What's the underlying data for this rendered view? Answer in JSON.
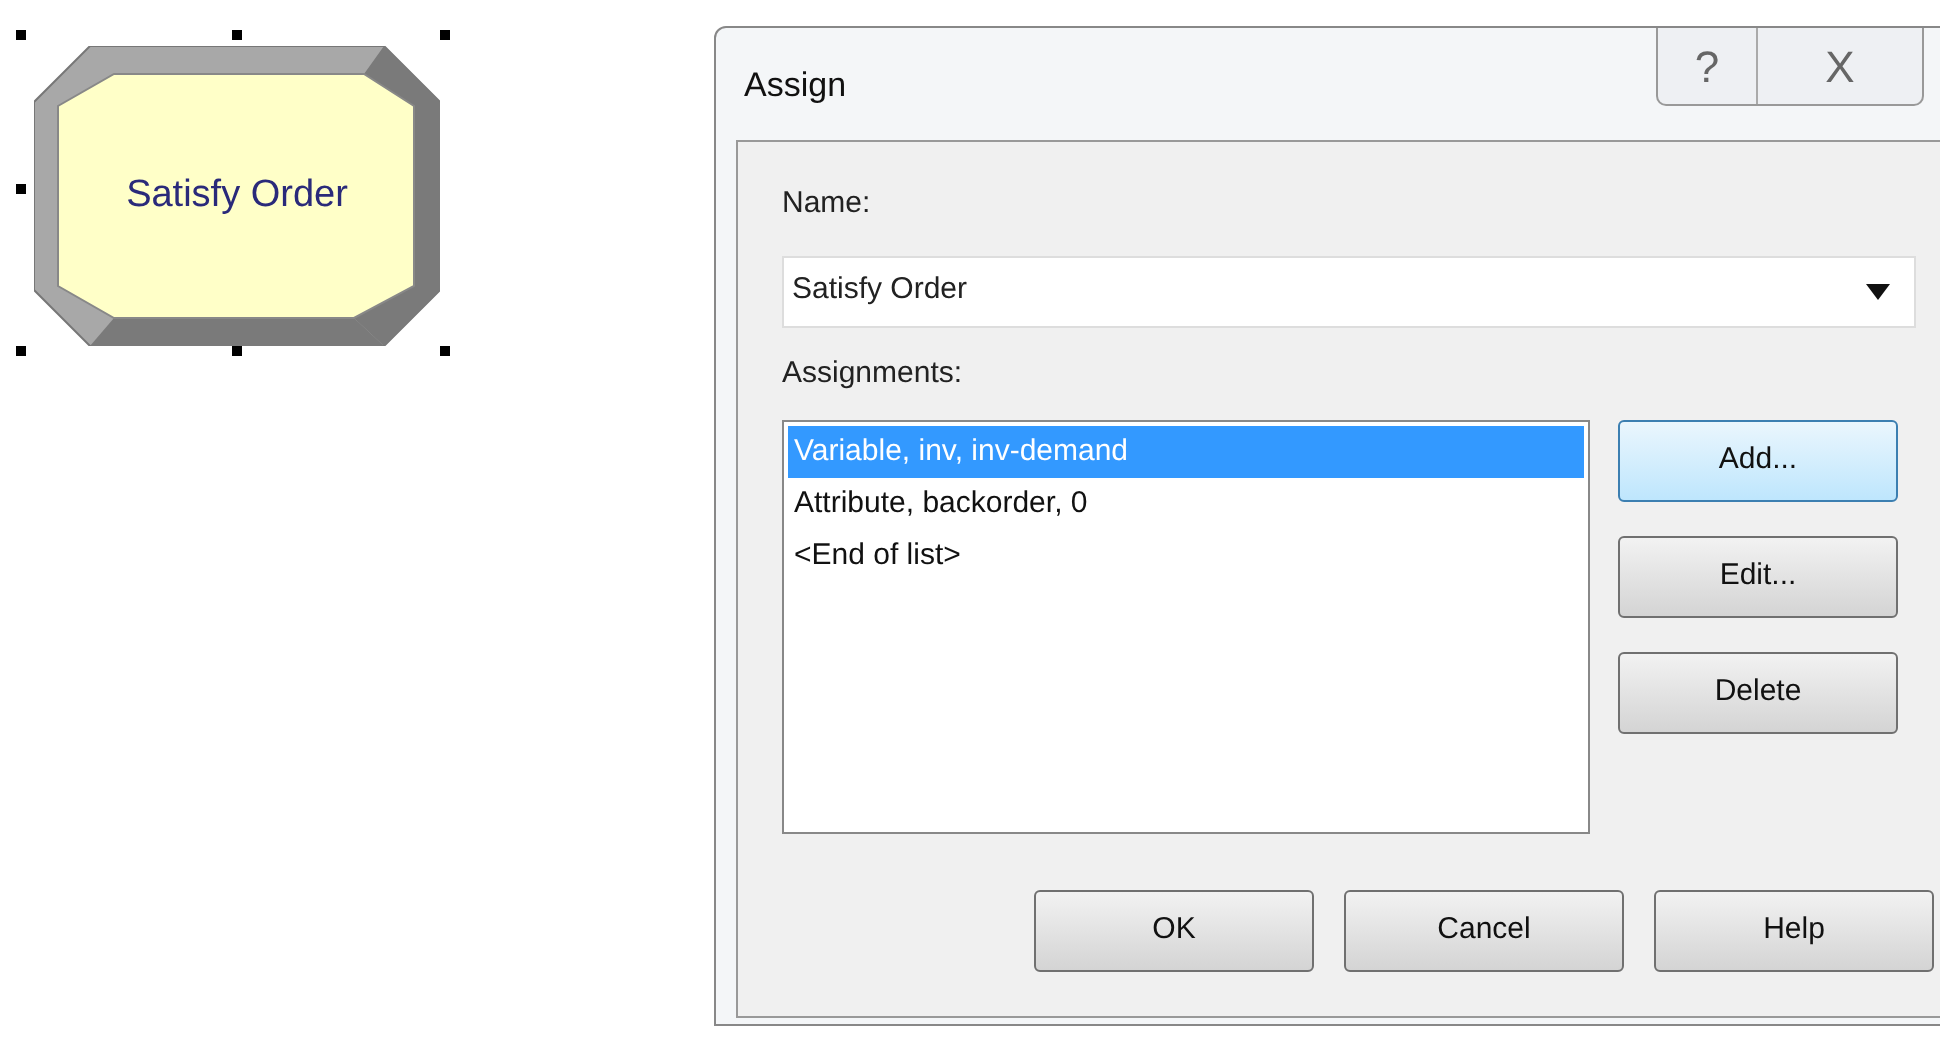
{
  "module": {
    "label": "Satisfy Order"
  },
  "dialog": {
    "title": "Assign",
    "help_button": "?",
    "close_button": "X",
    "name_label": "Name:",
    "name_value": "Satisfy Order",
    "assignments_label": "Assignments:",
    "assignments": [
      {
        "text": "Variable, inv, inv-demand",
        "selected": true
      },
      {
        "text": "Attribute, backorder, 0",
        "selected": false
      },
      {
        "text": "<End of list>",
        "selected": false
      }
    ],
    "side_buttons": [
      {
        "label": "Add...",
        "focused": true
      },
      {
        "label": "Edit...",
        "focused": false
      },
      {
        "label": "Delete",
        "focused": false
      }
    ],
    "bottom_buttons": [
      "OK",
      "Cancel",
      "Help"
    ]
  }
}
